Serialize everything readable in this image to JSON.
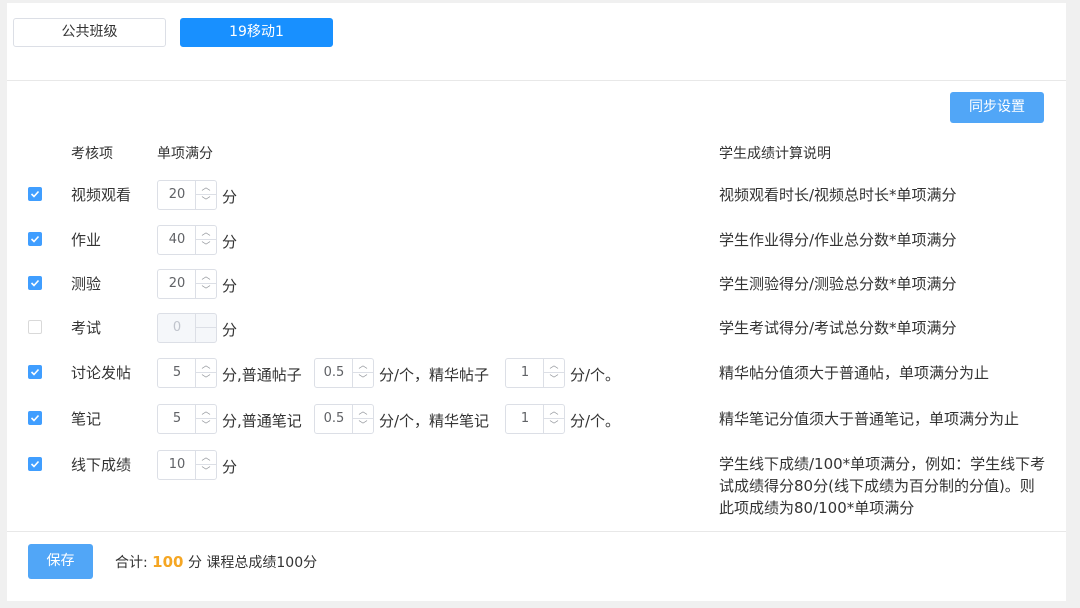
{
  "class_tabs": [
    {
      "label": "公共班级",
      "active": false
    },
    {
      "label": "19移动1",
      "active": true
    }
  ],
  "sync_button": "同步设置",
  "headers": {
    "item": "考核项",
    "max_score": "单项满分",
    "explanation": "学生成绩计算说明"
  },
  "unit": "分",
  "rows": [
    {
      "label": "视频观看",
      "checked": true,
      "value": "20",
      "desc": "视频观看时长/视频总时长*单项满分"
    },
    {
      "label": "作业",
      "checked": true,
      "value": "40",
      "desc": "学生作业得分/作业总分数*单项满分"
    },
    {
      "label": "测验",
      "checked": true,
      "value": "20",
      "desc": "学生测验得分/测验总分数*单项满分"
    },
    {
      "label": "考试",
      "checked": false,
      "value": "0",
      "desc": "学生考试得分/考试总分数*单项满分"
    },
    {
      "label": "讨论发帖",
      "checked": true,
      "value": "5",
      "sub1_label": "分,普通帖子",
      "sub1_value": "0.5",
      "sub2_label": "分/个，精华帖子",
      "sub2_value": "1",
      "sub_end": "分/个。",
      "desc": "精华帖分值须大于普通帖，单项满分为止"
    },
    {
      "label": "笔记",
      "checked": true,
      "value": "5",
      "sub1_label": "分,普通笔记",
      "sub1_value": "0.5",
      "sub2_label": "分/个，精华笔记",
      "sub2_value": "1",
      "sub_end": "分/个。",
      "desc": "精华笔记分值须大于普通笔记，单项满分为止"
    },
    {
      "label": "线下成绩",
      "checked": true,
      "value": "10",
      "desc": "学生线下成绩/100*单项满分，例如：学生线下考试成绩得分80分(线下成绩为百分制的分值)。则此项成绩为80/100*单项满分"
    }
  ],
  "footer": {
    "save": "保存",
    "total_label": "合计:",
    "total_value": "100",
    "total_unit": "分",
    "course_total": "课程总成绩100分"
  },
  "colors": {
    "primary": "#1890ff",
    "button": "#51a6f7",
    "checkbox": "#409eff",
    "total": "#f5a623"
  }
}
